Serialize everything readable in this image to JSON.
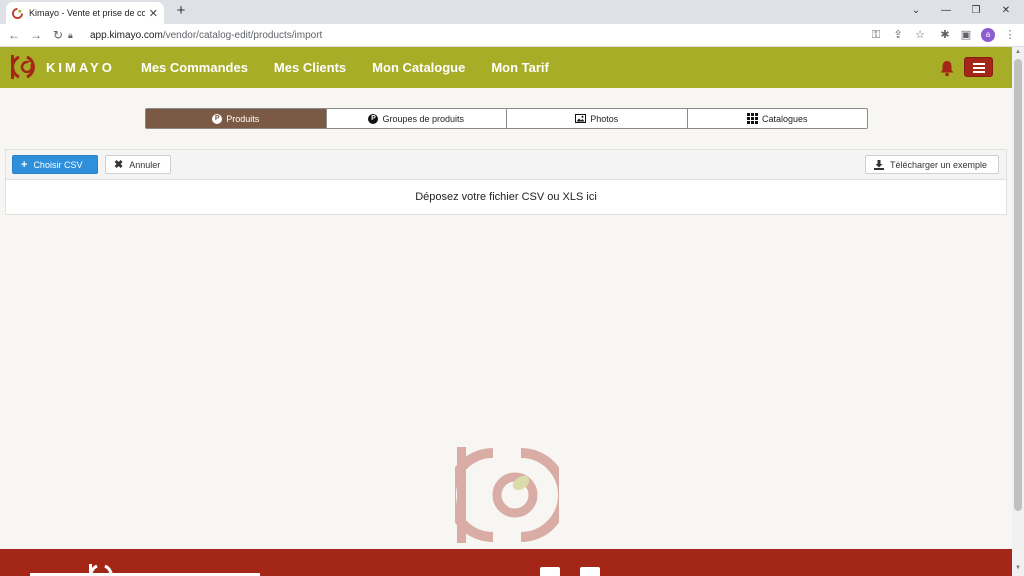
{
  "browser": {
    "tab_title": "Kimayo - Vente et prise de comm",
    "tab_close": "✕",
    "new_tab": "+",
    "url_domain": "app.kimayo.com",
    "url_path": "/vendor/catalog-edit/products/import",
    "profile_initial": "a",
    "window_controls": [
      "⌄",
      "—",
      "❐",
      "✕"
    ]
  },
  "header": {
    "brand": "KIMAYO",
    "nav": [
      "Mes Commandes",
      "Mes Clients",
      "Mon Catalogue",
      "Mon Tarif"
    ]
  },
  "tabs": [
    {
      "label": "Produits",
      "icon": "product-circle-icon",
      "active": true
    },
    {
      "label": "Groupes de produits",
      "icon": "product-group-icon",
      "active": false
    },
    {
      "label": "Photos",
      "icon": "image-icon",
      "active": false
    },
    {
      "label": "Catalogues",
      "icon": "grid-icon",
      "active": false
    }
  ],
  "upload": {
    "choose_label": "Choisir CSV",
    "cancel_label": "Annuler",
    "download_label": "Télécharger un exemple",
    "dropzone_text": "Déposez votre fichier CSV ou XLS ici"
  },
  "colors": {
    "header": "#a7ad27",
    "accent_red": "#a42617",
    "active_tab": "#7a5a45",
    "primary_button": "#2e8fdb"
  }
}
